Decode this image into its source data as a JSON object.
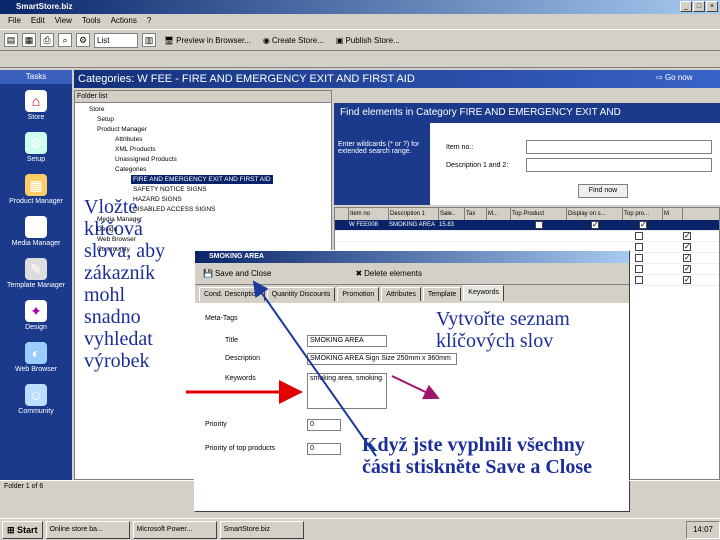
{
  "window": {
    "title": "SmartStore.biz"
  },
  "menu": [
    "File",
    "Edit",
    "View",
    "Tools",
    "Actions",
    "?"
  ],
  "toolbar": {
    "combo": "List",
    "preview": "Preview in Browser...",
    "create_store": "Create Store...",
    "publish": "Publish Store..."
  },
  "tasks": {
    "header": "Tasks",
    "items": [
      "Store",
      "Setup",
      "Product Manager",
      "Media Manager",
      "Template Manager",
      "Design",
      "Web Browser",
      "Community"
    ]
  },
  "main_header": {
    "title": "Categories: W FEE - FIRE AND EMERGENCY EXIT AND FIRST AID",
    "go_now": "Go now"
  },
  "tree": {
    "header": "Folder list",
    "nodes": [
      "Store",
      "Setup",
      "Product Manager",
      "Attributes",
      "XML Products",
      "Unassigned Products",
      "Categories",
      "FIRE AND EMERGENCY EXIT AND FIRST AID",
      "SAFETY NOTICE SIGNS",
      "HAZARD SIGNS",
      "DISABLED ACCESS SIGNS",
      "Media Manager",
      "Design",
      "Web Browser",
      "Community"
    ],
    "status": "Folder 1 of 6"
  },
  "find": {
    "title": "Find elements in Category FIRE AND EMERGENCY EXIT AND",
    "hint": "Enter wildcards (* or ?) for extended search range.",
    "item_label": "Item no.:",
    "desc_label": "Description 1 and 2:",
    "button": "Find now"
  },
  "grid": {
    "columns": [
      "Item no",
      "Description 1",
      "Sale..",
      "Tax",
      "M...",
      "Top Product",
      "Display on s...",
      "Top pro...",
      "M"
    ],
    "rows": [
      {
        "item": "W FEE008",
        "desc": "SMOKING AREA",
        "sale": "15.83"
      }
    ]
  },
  "dialog": {
    "title": "SMOKING AREA",
    "save_close": "Save and Close",
    "delete": "Delete elements",
    "tabs": [
      "Cond. Description",
      "Quantity Discounts",
      "Promotion",
      "Attributes",
      "Template",
      "Keywords"
    ],
    "meta_tags": "Meta-Tags",
    "title_label": "Title",
    "title_value": "SMOKING AREA",
    "desc_label": "Description",
    "desc_value": "SMOKING AREA Sign Size 250mm x 360mm",
    "keywords_label": "Keywords",
    "keywords_value": "smoking area, smoking",
    "priority_label": "Priority",
    "priority_value": "0",
    "priority_top_label": "Priority of top products",
    "priority_top_value": "0"
  },
  "taskbar": {
    "start": "Start",
    "apps": [
      "Online store ba...",
      "Microsoft Power...",
      "SmartStore.biz"
    ],
    "clock": "14:07"
  },
  "annotations": {
    "left": "Vložte klíčová slova, aby zákazník mohl snadno vyhledat výrobek",
    "right": "Vytvořte seznam klíčových slov",
    "bottom": "Když jste vyplnili všechny části stiskněte Save a Close"
  }
}
